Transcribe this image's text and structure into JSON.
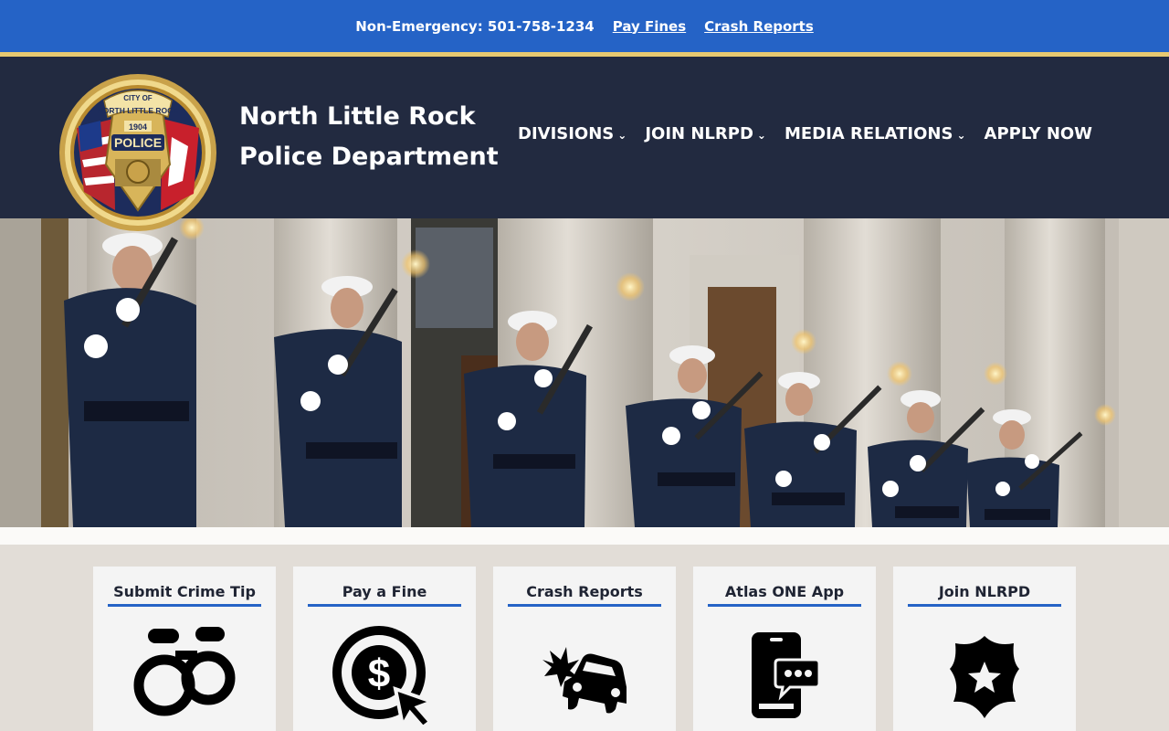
{
  "topbar": {
    "non_emergency": "Non-Emergency: 501-758-1234",
    "links": [
      "Pay Fines",
      "Crash Reports"
    ]
  },
  "badge": {
    "top_text": "CITY OF",
    "city": "NORTH LITTLE ROCK",
    "year": "1904",
    "main": "POLICE"
  },
  "site": {
    "title_line1": "North Little Rock",
    "title_line2": "Police Department"
  },
  "nav": {
    "items": [
      "DIVISIONS",
      "JOIN NLRPD",
      "MEDIA RELATIONS",
      "APPLY NOW"
    ]
  },
  "cards": [
    {
      "title": "Submit Crime Tip",
      "icon": "handcuffs-icon"
    },
    {
      "title": "Pay a Fine",
      "icon": "dollar-click-icon"
    },
    {
      "title": "Crash Reports",
      "icon": "car-crash-icon"
    },
    {
      "title": "Atlas ONE App",
      "icon": "phone-chat-icon"
    },
    {
      "title": "Join NLRPD",
      "icon": "police-badge-icon"
    }
  ],
  "colors": {
    "topbar": "#2563c6",
    "gold": "#e7c971",
    "header": "#222a40",
    "accent": "#2563c6"
  }
}
